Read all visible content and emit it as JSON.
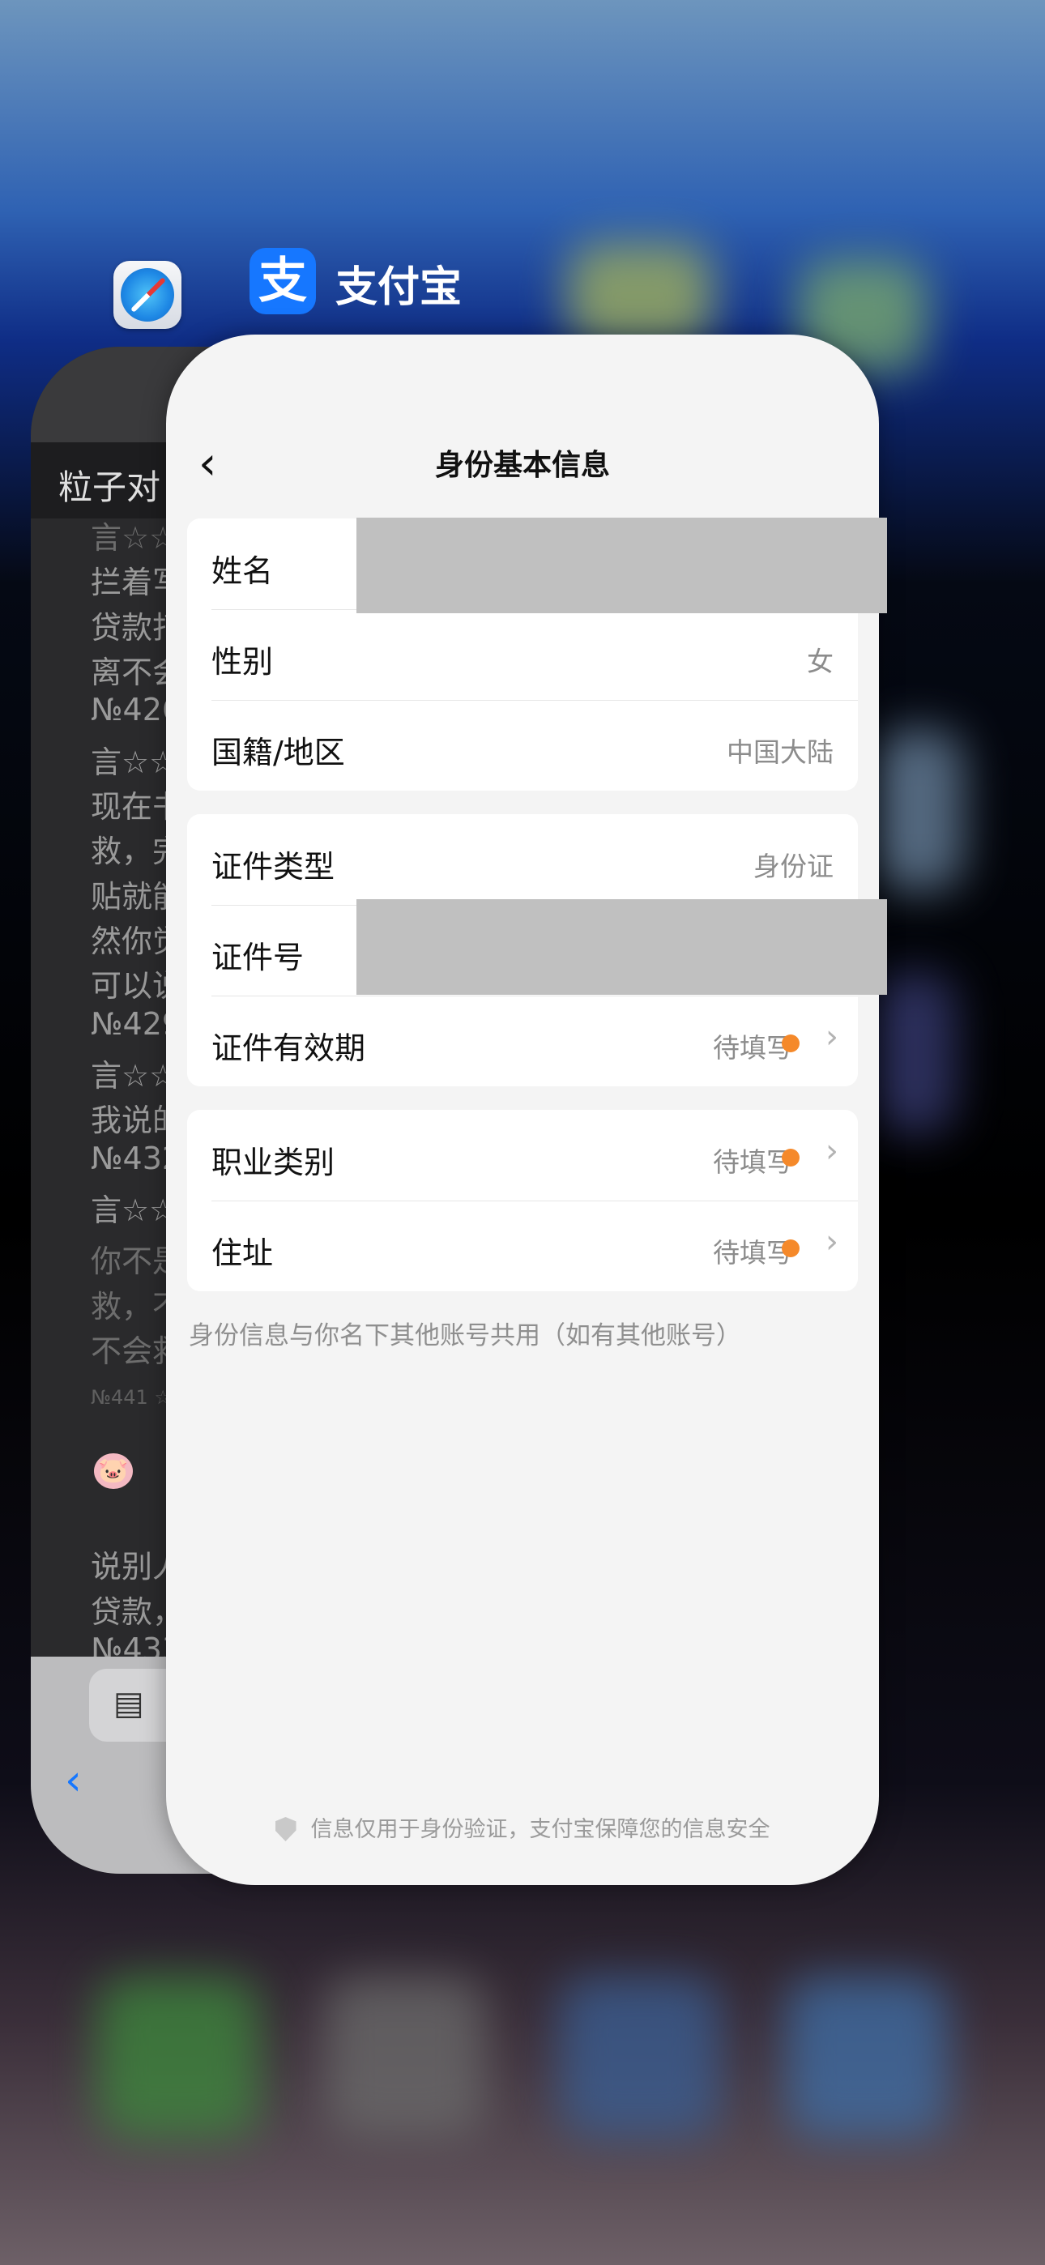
{
  "switcher": {
    "app_name": "支付宝"
  },
  "background_card": {
    "title": "粒子对",
    "lines": [
      "言☆☆",
      "拦着写",
      "贷款打",
      "离不会",
      "№426",
      "言☆☆",
      "现在书",
      "救，完",
      "贴就能",
      "然你觉",
      "可以说",
      "№429",
      "言☆☆",
      "我说的",
      "№432",
      "言☆☆"
    ],
    "lower_lines": [
      "你不是",
      "救，不",
      "不会救"
    ],
    "small_ref": "№441 ☆",
    "after_lines": [
      "说别人",
      "贷款，",
      "№433"
    ]
  },
  "page": {
    "title": "身份基本信息",
    "group1": [
      {
        "label": "姓名",
        "value": ""
      },
      {
        "label": "性别",
        "value": "女"
      },
      {
        "label": "国籍/地区",
        "value": "中国大陆"
      }
    ],
    "group2": [
      {
        "label": "证件类型",
        "value": "身份证"
      },
      {
        "label": "证件号",
        "value": ""
      },
      {
        "label": "证件有效期",
        "value": "待填写"
      }
    ],
    "group3": [
      {
        "label": "职业类别",
        "value": "待填写"
      },
      {
        "label": "住址",
        "value": "待填写"
      }
    ],
    "note": "身份信息与你名下其他账号共用（如有其他账号）",
    "footer": "信息仅用于身份验证，支付宝保障您的信息安全"
  },
  "colors": {
    "accent_blue": "#1677ff",
    "pending_dot": "#f5892a",
    "redaction": "#c0c0c0"
  }
}
